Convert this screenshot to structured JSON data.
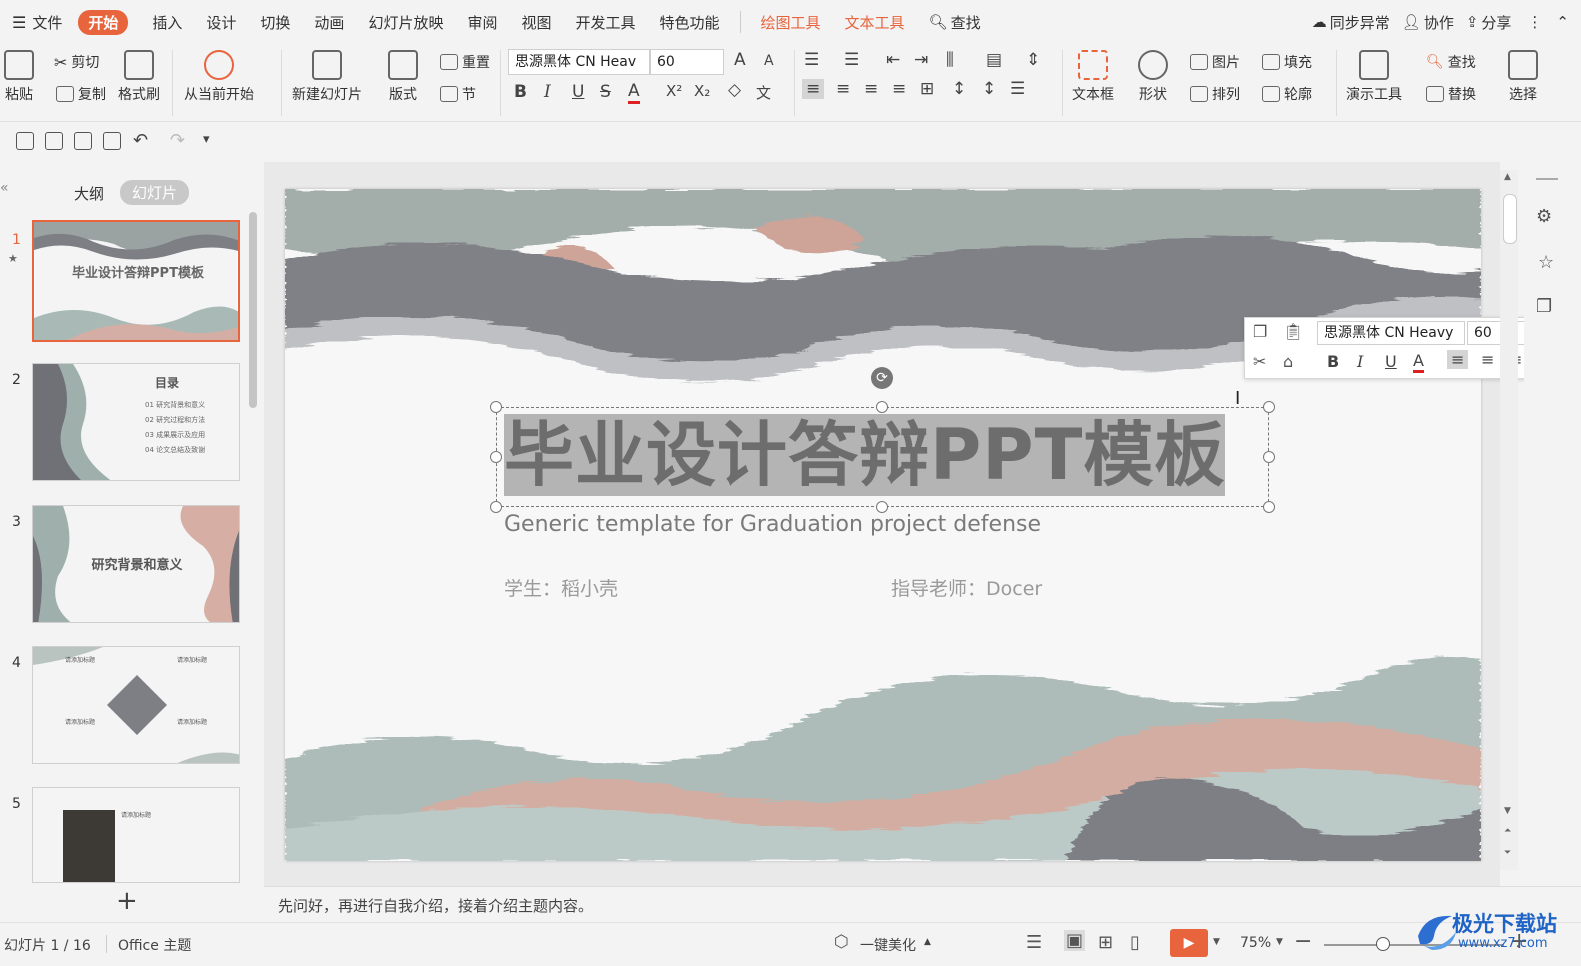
{
  "menubar": {
    "file": "文件",
    "tabs": [
      "开始",
      "插入",
      "设计",
      "切换",
      "动画",
      "幻灯片放映",
      "审阅",
      "视图",
      "开发工具",
      "特色功能"
    ],
    "context_tabs": [
      "绘图工具",
      "文本工具"
    ],
    "search": "查找",
    "sync": "同步异常",
    "collab": "协作",
    "share": "分享"
  },
  "ribbon": {
    "paste": "粘贴",
    "cut": "剪切",
    "copy": "复制",
    "format_painter": "格式刷",
    "from_current": "从当前开始",
    "new_slide": "新建幻灯片",
    "layout": "版式",
    "reset": "重置",
    "section": "节",
    "font_name": "思源黑体 CN Heav",
    "font_size": "60",
    "textbox": "文本框",
    "shape": "形状",
    "picture": "图片",
    "arrange": "排列",
    "fill": "填充",
    "outline": "轮廓",
    "present_tools": "演示工具",
    "find": "查找",
    "replace": "替换",
    "select": "选择"
  },
  "left_panel": {
    "tab_outline": "大纲",
    "tab_slides": "幻灯片",
    "slides": [
      {
        "num": "1",
        "title": "毕业设计答辩PPT模板"
      },
      {
        "num": "2",
        "title": "目录",
        "items": [
          "01  研究背景和意义",
          "02  研究过程和方法",
          "03  成果展示及应用",
          "04  论文总结及致谢"
        ]
      },
      {
        "num": "3",
        "title": "研究背景和意义"
      },
      {
        "num": "4",
        "title": "请添加标题"
      },
      {
        "num": "5",
        "title": "请添加标题"
      }
    ]
  },
  "slide": {
    "title": "毕业设计答辩PPT模板",
    "subtitle": "Generic template for Graduation project defense",
    "student": "学生：稻小壳",
    "advisor": "指导老师：Docer"
  },
  "mini_toolbar": {
    "font_name": "思源黑体 CN Heavy",
    "font_size": "60"
  },
  "notes": "先问好，再进行自我介绍，接着介绍主题内容。",
  "status": {
    "slide_info": "幻灯片 1 / 16",
    "theme": "Office 主题",
    "beautify": "一键美化",
    "zoom": "75%"
  },
  "watermark": {
    "brand": "极光下载站",
    "url": "www.xz7.com"
  },
  "colors": {
    "accent": "#e8643c",
    "wave_gray": "#8a8c90",
    "wave_sage": "#a7b6b2",
    "wave_pink": "#d8aea3"
  }
}
